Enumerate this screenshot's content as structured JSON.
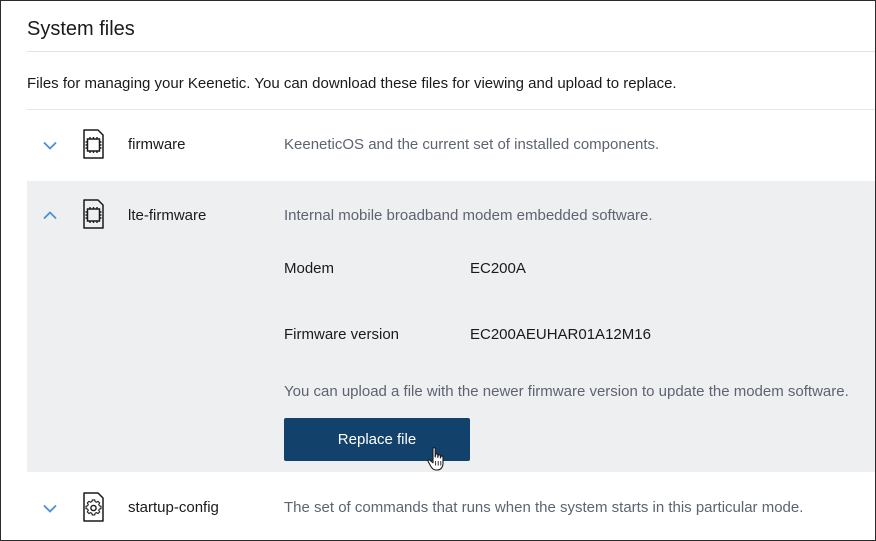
{
  "page": {
    "title": "System files",
    "description": "Files for managing your Keenetic. You can download these files for viewing and upload to replace."
  },
  "files": [
    {
      "name": "firmware",
      "description": "KeeneticOS and the current set of installed components.",
      "icon": "chip-icon",
      "expanded": false
    },
    {
      "name": "lte-firmware",
      "description": "Internal mobile broadband modem embedded software.",
      "icon": "chip-icon",
      "expanded": true,
      "details": {
        "modem_label": "Modem",
        "modem_value": "EC200A",
        "firmware_label": "Firmware version",
        "firmware_value": "EC200AEUHAR01A12M16",
        "note": "You can upload a file with the newer firmware version to update the modem software.",
        "button_label": "Replace file"
      }
    },
    {
      "name": "startup-config",
      "description": "The set of commands that runs when the system starts in this particular mode.",
      "icon": "gear-icon",
      "expanded": false
    }
  ],
  "colors": {
    "accent_chevron": "#4d8fd1",
    "button_bg": "#12416b",
    "expanded_bg": "#eeeff1",
    "muted_text": "#5d6470"
  }
}
